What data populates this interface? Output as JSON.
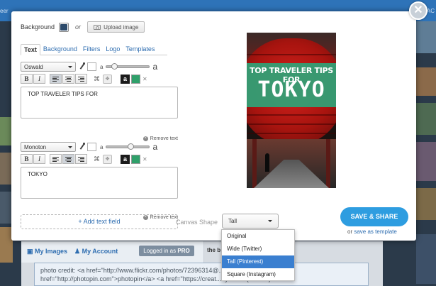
{
  "background_page": {
    "left_text": "eer",
    "right_text": "CONTAC",
    "links": [
      "My Images",
      "My Account"
    ],
    "badge_prefix": "Logged in as",
    "badge_pro": "PRO",
    "note": "the b",
    "credit_text": "photo credit: <a href=\"http://www.flickr.com/photos/72396314@...\">arimon</a> via <a href=\"http://photopin.com\">photopin</a> <a href=\"https://creat...by/2.0/\">(license)</a>"
  },
  "modal": {
    "close_glyph": "✕",
    "background_label": "Background",
    "background_color": "#2d4a6a",
    "or_label": "or",
    "upload_label": "Upload image",
    "tabs": [
      {
        "label": "Text",
        "active": true
      },
      {
        "label": "Background",
        "active": false
      },
      {
        "label": "Filters",
        "active": false
      },
      {
        "label": "Logo",
        "active": false
      },
      {
        "label": "Templates",
        "active": false
      }
    ],
    "editors": [
      {
        "font": "Oswald",
        "size_small": "a",
        "size_big": "a",
        "text": "TOP TRAVELER TIPS FOR",
        "remove_label": "Remove text",
        "bold": "B",
        "italic": "I",
        "bg_a": "a"
      },
      {
        "font": "Monoton",
        "size_small": "a",
        "size_big": "a",
        "text": "TOKYO",
        "remove_label": "Remove text",
        "bold": "B",
        "italic": "I",
        "bg_a": "a"
      }
    ],
    "add_text_field": "+ Add text field",
    "canvas_shape_label": "Canvas Shape",
    "canvas_shape_value": "Tall",
    "canvas_shape_options": [
      "Original",
      "Wide (Twitter)",
      "Tall (Pinterest)",
      "Square (Instagram)"
    ],
    "canvas_shape_highlighted": "Tall (Pinterest)",
    "save_share_label": "SAVE & SHARE",
    "save_template_prefix": "or",
    "save_template_link": "save as template",
    "accent_color": "#2e9de0",
    "poster": {
      "line1": "TOP TRAVELER TIPS FOR",
      "line2": "TOKYO",
      "band_color": "#2fa377"
    }
  }
}
